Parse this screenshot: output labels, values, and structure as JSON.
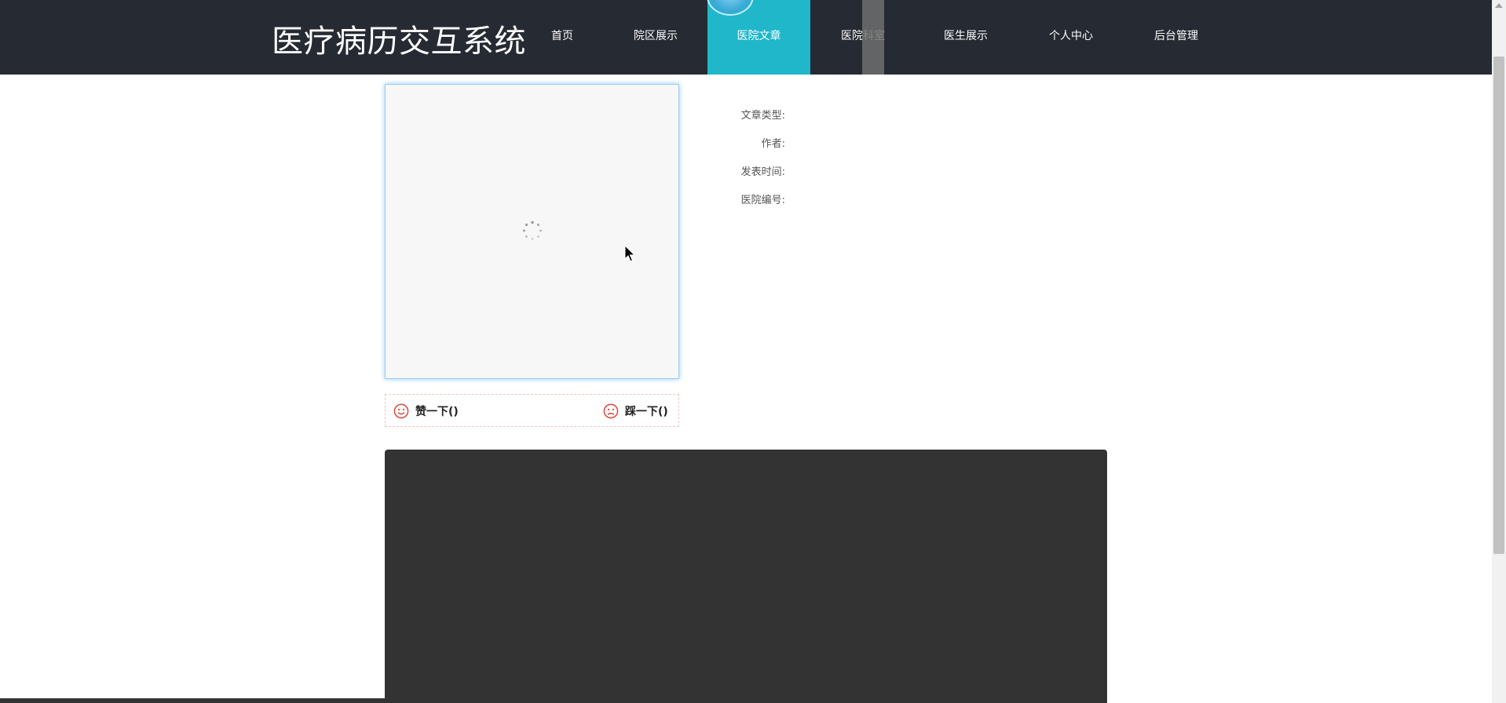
{
  "header": {
    "site_title": "医疗病历交互系统",
    "nav": [
      {
        "label": "首页",
        "active": false
      },
      {
        "label": "院区展示",
        "active": false
      },
      {
        "label": "医院文章",
        "active": true
      },
      {
        "label": "医院科室",
        "active": false
      },
      {
        "label": "医生展示",
        "active": false
      },
      {
        "label": "个人中心",
        "active": false
      },
      {
        "label": "后台管理",
        "active": false
      }
    ]
  },
  "article": {
    "image_state": "loading",
    "vote": {
      "like_label": "赞一下()",
      "dislike_label": "踩一下()"
    },
    "info": [
      {
        "label": "文章类型:",
        "value": ""
      },
      {
        "label": "作者:",
        "value": ""
      },
      {
        "label": "发表时间:",
        "value": ""
      },
      {
        "label": "医院编号:",
        "value": ""
      }
    ]
  },
  "colors": {
    "header_bg": "#262a33",
    "nav_active": "#1fb7c9",
    "content_block": "#333333",
    "vote_icon": "#e0463a"
  },
  "icons": {
    "like": "smile-face-icon",
    "dislike": "frown-face-icon",
    "loading": "loading-spinner-icon",
    "cursor": "mouse-pointer-icon"
  }
}
